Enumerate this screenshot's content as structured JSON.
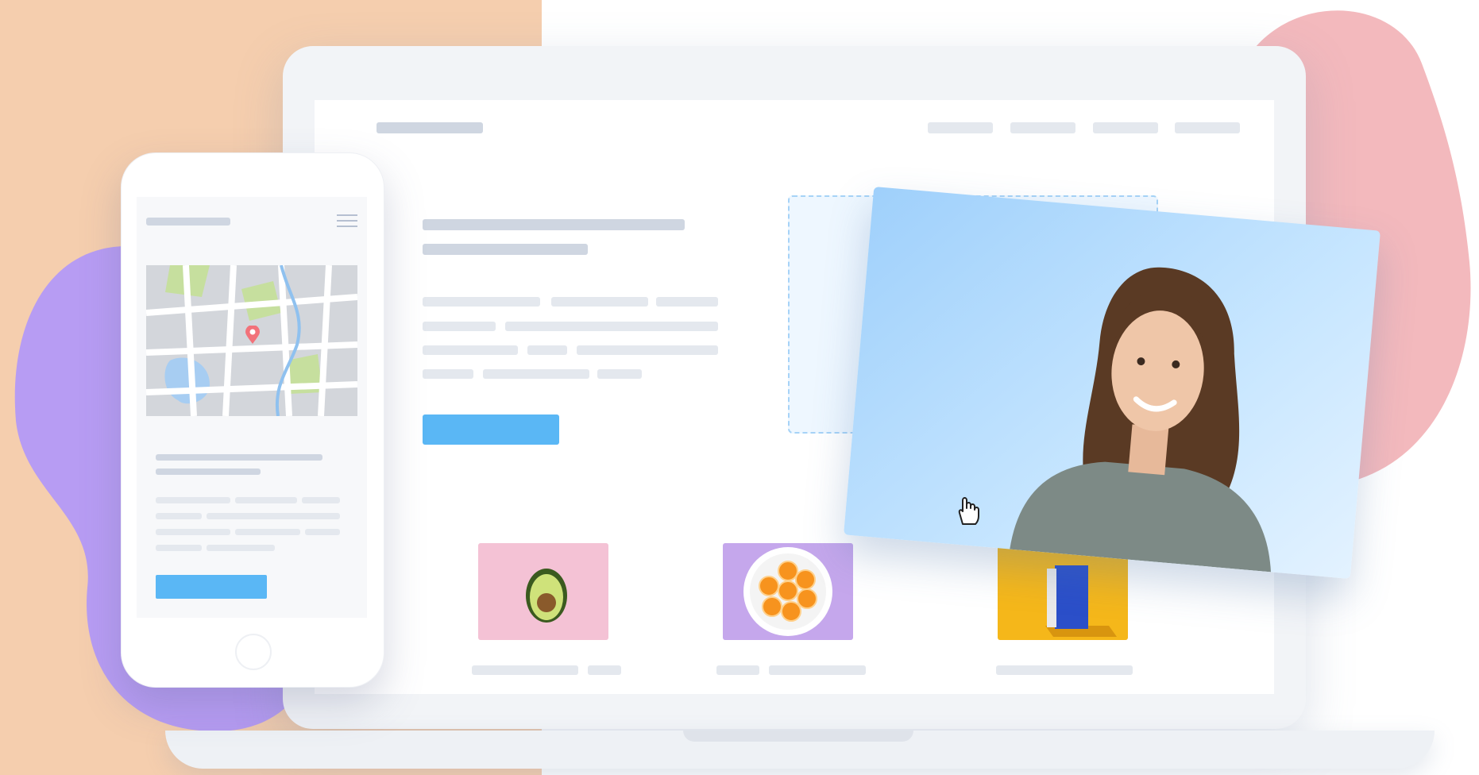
{
  "colors": {
    "peach": "#f5ceae",
    "purple_blob": "#b79cf3",
    "pink_blob": "#f3b9bd",
    "laptop_frame": "#f2f4f7",
    "screen_bg": "#ffffff",
    "skeleton": "#e4e8ee",
    "skeleton_dark": "#b6c0d1",
    "accent_button": "#5ab7f5",
    "photo_bg": "#a9d5fb"
  },
  "icons": {
    "menu": "hamburger-menu-icon",
    "map_pin": "map-pin-icon",
    "cursor": "hand-cursor-icon",
    "home": "home-button-icon"
  },
  "products": [
    {
      "name": "avocado",
      "bg": "#f4c2d5"
    },
    {
      "name": "orange-slices",
      "bg": "#c5a7ec"
    },
    {
      "name": "book",
      "bg": "#f5b71a"
    }
  ]
}
